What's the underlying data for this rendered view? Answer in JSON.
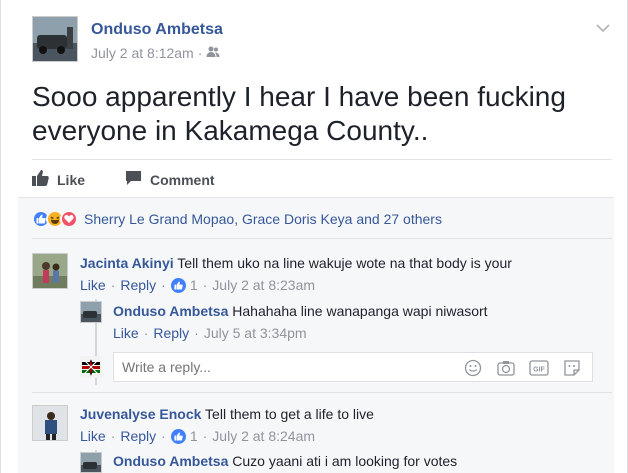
{
  "post": {
    "author": "Onduso Ambetsa",
    "timestamp": "July 2 at 8:12am",
    "text": "Sooo apparently I hear I have been fucking everyone in Kakamega County..",
    "privacy_icon": "friends-icon"
  },
  "actions": {
    "like_label": "Like",
    "comment_label": "Comment"
  },
  "reactions": {
    "icons": [
      "like-icon",
      "haha-icon",
      "love-icon"
    ],
    "names": "Sherry Le Grand Mopao, Grace Doris Keya and 27 others"
  },
  "comments": [
    {
      "author": "Jacinta Akinyi",
      "text": "Tell them uko na line wakuje wote na that body is your",
      "like_label": "Like",
      "reply_label": "Reply",
      "like_count": "1",
      "timestamp": "July 2 at 8:23am",
      "replies": [
        {
          "author": "Onduso Ambetsa",
          "text": "Hahahaha line wanapanga wapi niwasort",
          "like_label": "Like",
          "reply_label": "Reply",
          "timestamp": "July 5 at 3:34pm"
        }
      ]
    },
    {
      "author": "Juvenalyse Enock",
      "text": "Tell them to get a life to live",
      "like_label": "Like",
      "reply_label": "Reply",
      "like_count": "1",
      "timestamp": "July 2 at 8:24am",
      "replies": [
        {
          "author": "Onduso Ambetsa",
          "text": "Cuzo yaani ati i am looking for votes"
        }
      ]
    }
  ],
  "reply_box": {
    "placeholder": "Write a reply...",
    "icons": [
      "emoji-icon",
      "camera-icon",
      "gif-icon",
      "sticker-icon"
    ]
  },
  "colors": {
    "link": "#365899",
    "muted": "#90949c",
    "like_blue": "#4080ff",
    "love_red": "#f25268",
    "haha_yellow": "#f7b125"
  }
}
